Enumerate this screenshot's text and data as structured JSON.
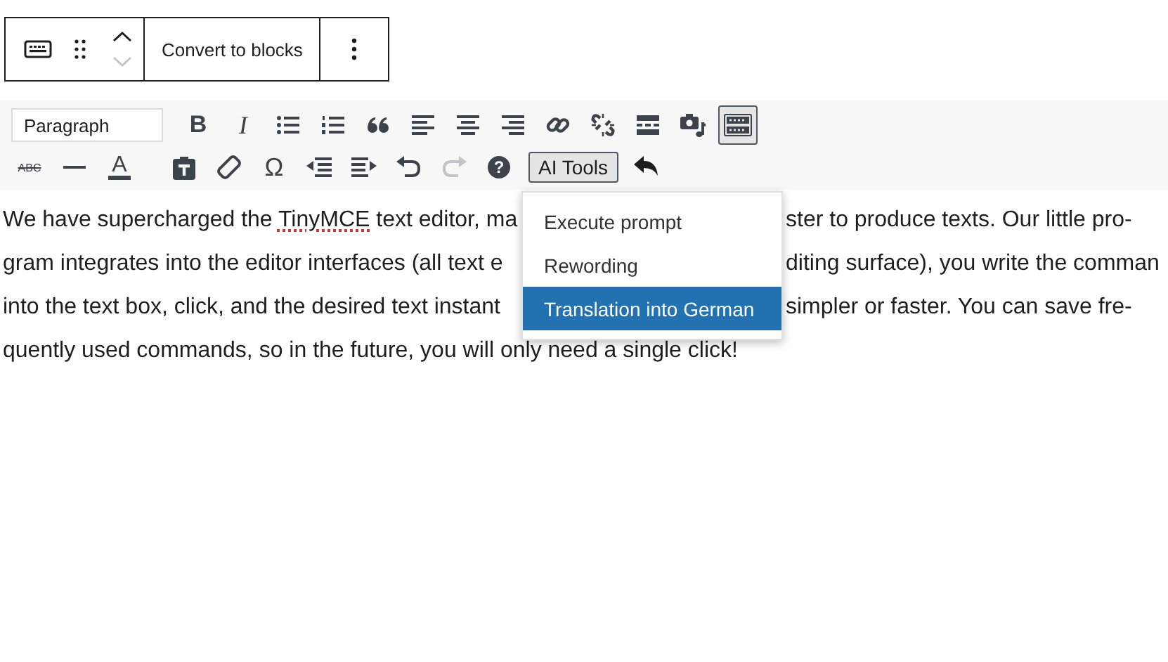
{
  "block_toolbar": {
    "move_up": {
      "disabled": false
    },
    "move_down": {
      "disabled": true
    },
    "convert_button": "Convert to blocks"
  },
  "editor_toolbar": {
    "format_select": "Paragraph",
    "bold_glyph": "B",
    "italic_glyph": "I",
    "toolbar_toggle": {
      "pressed": true
    },
    "strike_glyph": "ABC",
    "color_glyph": "A",
    "special_char_glyph": "Ω",
    "redo": {
      "disabled": true
    },
    "help_glyph": "?",
    "ai_tools": {
      "label": "AI Tools",
      "expanded": true
    }
  },
  "ai_menu": {
    "items": [
      {
        "label": "Execute prompt",
        "selected": false
      },
      {
        "label": "Rewording",
        "selected": false
      },
      {
        "label": "Translation into German",
        "selected": true
      }
    ]
  },
  "paragraph": {
    "lines": [
      {
        "left": [
          {
            "text": "We have supercharged the "
          },
          {
            "text": "TinyMCE",
            "misspelled": true
          },
          {
            "text": " text editor, ma"
          }
        ],
        "right": "ster to produce texts. Our little pro-"
      },
      {
        "left": [
          {
            "text": "gram integrates into the editor interfaces (all text e"
          }
        ],
        "right": "diting surface), you write the comman"
      },
      {
        "left": [
          {
            "text": "into the text box, click, and the desired text instant"
          }
        ],
        "right": "simpler or faster. You can save fre-"
      },
      {
        "left": [
          {
            "text": "quently used commands, so in the future, you will only need a single click!"
          }
        ]
      }
    ]
  }
}
